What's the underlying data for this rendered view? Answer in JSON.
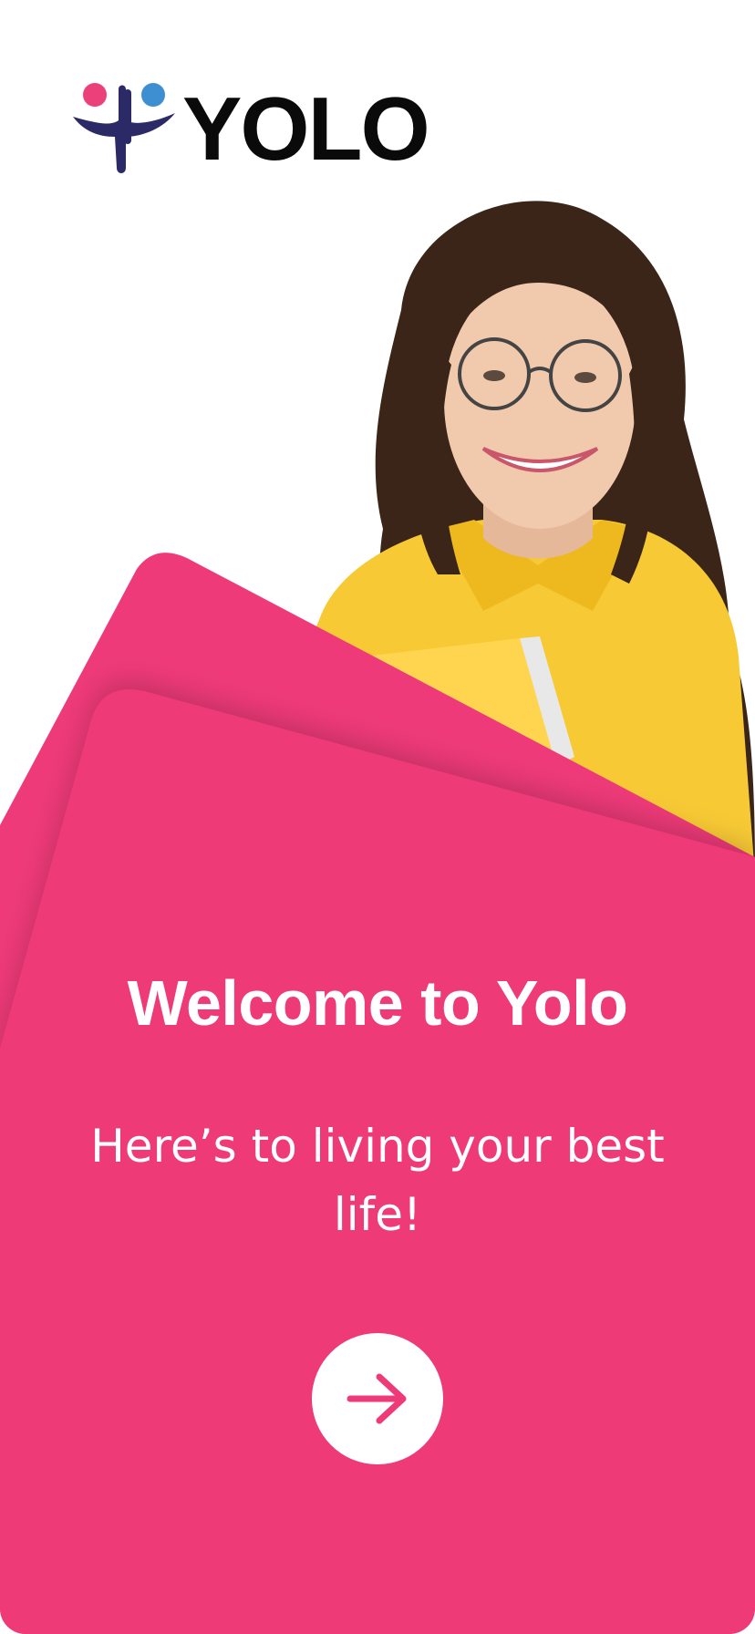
{
  "brand": {
    "name": "YOLO",
    "colors": {
      "pink": "#EE3A78",
      "navy": "#2B2A66",
      "logo_pink": "#EC407A",
      "logo_blue": "#3D8FD1",
      "black": "#0A0A0A"
    }
  },
  "onboarding": {
    "title": "Welcome to Yolo",
    "subtitle": "Here’s to living your best life!",
    "next_button": {
      "icon": "arrow-right-icon"
    }
  },
  "hero_image": {
    "icon": "smiling-woman-illustration"
  }
}
